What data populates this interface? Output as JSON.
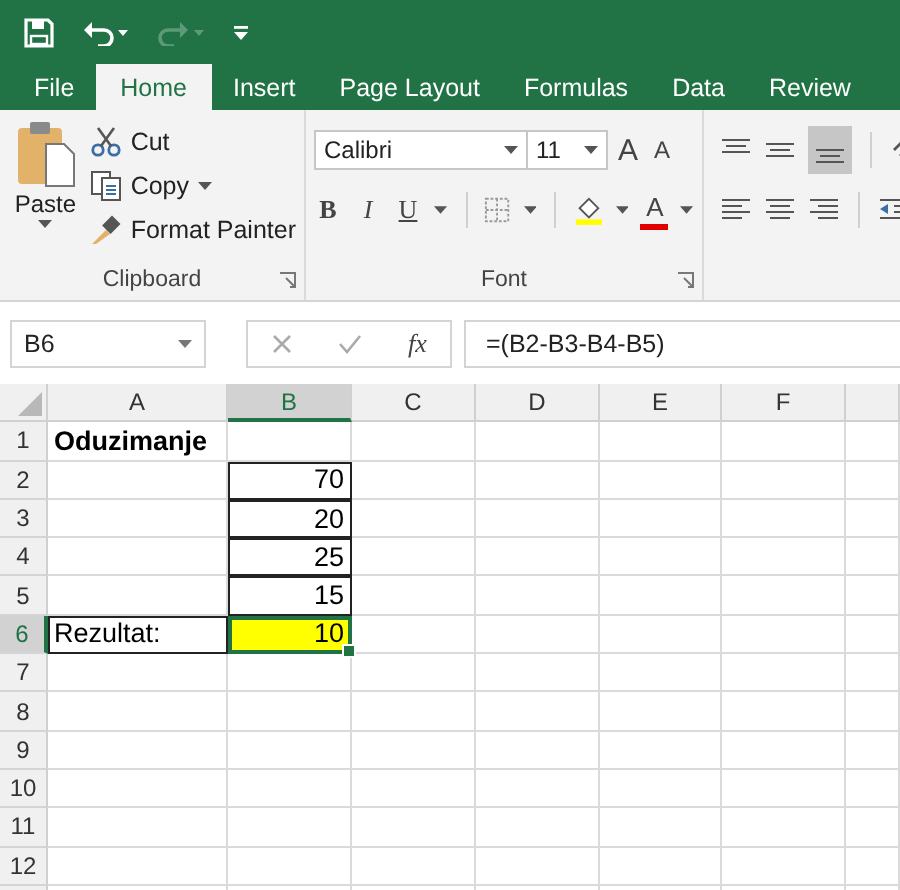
{
  "tabs": [
    {
      "label": "File",
      "selected": false
    },
    {
      "label": "Home",
      "selected": true
    },
    {
      "label": "Insert",
      "selected": false
    },
    {
      "label": "Page Layout",
      "selected": false
    },
    {
      "label": "Formulas",
      "selected": false
    },
    {
      "label": "Data",
      "selected": false
    },
    {
      "label": "Review",
      "selected": false
    }
  ],
  "clipboard": {
    "paste": "Paste",
    "cut": "Cut",
    "copy": "Copy",
    "format_painter": "Format Painter",
    "label": "Clipboard"
  },
  "font": {
    "name": "Calibri",
    "size": "11",
    "grow": "A",
    "shrink": "A",
    "bold": "B",
    "italic": "I",
    "underline": "U",
    "font_color": "A",
    "label": "Font"
  },
  "formula_bar": {
    "name_box": "B6",
    "fx": "fx",
    "formula": "=(B2-B3-B4-B5)"
  },
  "sheet": {
    "columns": [
      {
        "label": "A",
        "selected": false
      },
      {
        "label": "B",
        "selected": true
      },
      {
        "label": "C",
        "selected": false
      },
      {
        "label": "D",
        "selected": false
      },
      {
        "label": "E",
        "selected": false
      },
      {
        "label": "F",
        "selected": false
      }
    ],
    "rows": [
      {
        "label": "1",
        "selected": false,
        "cells": [
          {
            "text": "Oduzimanje",
            "bold": true,
            "bordered": false,
            "selected": false,
            "highlighted": false
          }
        ]
      },
      {
        "label": "2",
        "selected": false,
        "cells": [
          {},
          {
            "text": "70",
            "bold": false,
            "bordered": true,
            "selected": false,
            "highlighted": false
          }
        ]
      },
      {
        "label": "3",
        "selected": false,
        "cells": [
          {},
          {
            "text": "20",
            "bold": false,
            "bordered": true,
            "selected": false,
            "highlighted": false
          }
        ]
      },
      {
        "label": "4",
        "selected": false,
        "cells": [
          {},
          {
            "text": "25",
            "bold": false,
            "bordered": true,
            "selected": false,
            "highlighted": false
          }
        ]
      },
      {
        "label": "5",
        "selected": false,
        "cells": [
          {},
          {
            "text": "15",
            "bold": false,
            "bordered": true,
            "selected": false,
            "highlighted": false
          }
        ]
      },
      {
        "label": "6",
        "selected": true,
        "cells": [
          {
            "text": "Rezultat:",
            "bold": false,
            "bordered": true,
            "selected": false,
            "highlighted": false
          },
          {
            "text": "10",
            "bold": false,
            "bordered": true,
            "selected": true,
            "highlighted": true
          }
        ]
      },
      {
        "label": "7",
        "selected": false
      },
      {
        "label": "8",
        "selected": false
      },
      {
        "label": "9",
        "selected": false
      },
      {
        "label": "10",
        "selected": false
      },
      {
        "label": "11",
        "selected": false
      },
      {
        "label": "12",
        "selected": false
      }
    ]
  }
}
